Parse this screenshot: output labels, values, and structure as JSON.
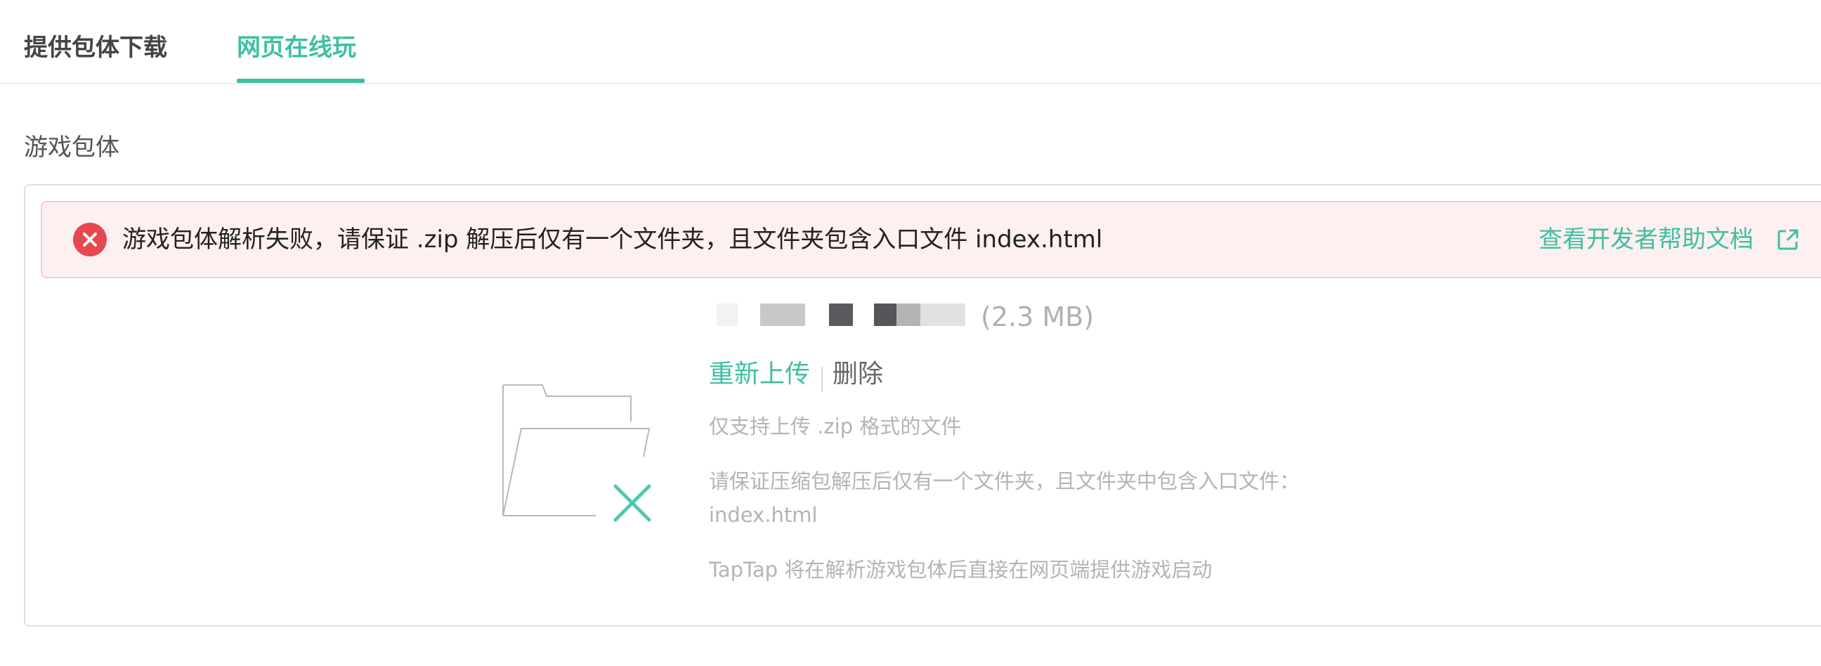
{
  "tabs": [
    {
      "label": "提供包体下载",
      "active": false
    },
    {
      "label": "网页在线玩",
      "active": true
    }
  ],
  "section": {
    "title": "游戏包体"
  },
  "alert": {
    "message": "游戏包体解析失败，请保证 .zip 解压后仅有一个文件夹，且文件夹包含入口文件 index.html",
    "link_label": "查看开发者帮助文档",
    "icon": "close-circle-icon",
    "link_icon": "external-link-icon"
  },
  "file": {
    "size_label": "(2.3 MB)"
  },
  "actions": {
    "reupload_label": "重新上传",
    "delete_label": "删除"
  },
  "hints": {
    "format": "仅支持上传 .zip 格式的文件",
    "structure_line1": "请保证压缩包解压后仅有一个文件夹，且文件夹中包含入口文件：",
    "structure_line2": "index.html",
    "launch": "TapTap 将在解析游戏包体后直接在网页端提供游戏启动"
  },
  "colors": {
    "accent": "#3fbfa2",
    "error": "#e5484d",
    "error_bg": "#fdf0f0"
  }
}
